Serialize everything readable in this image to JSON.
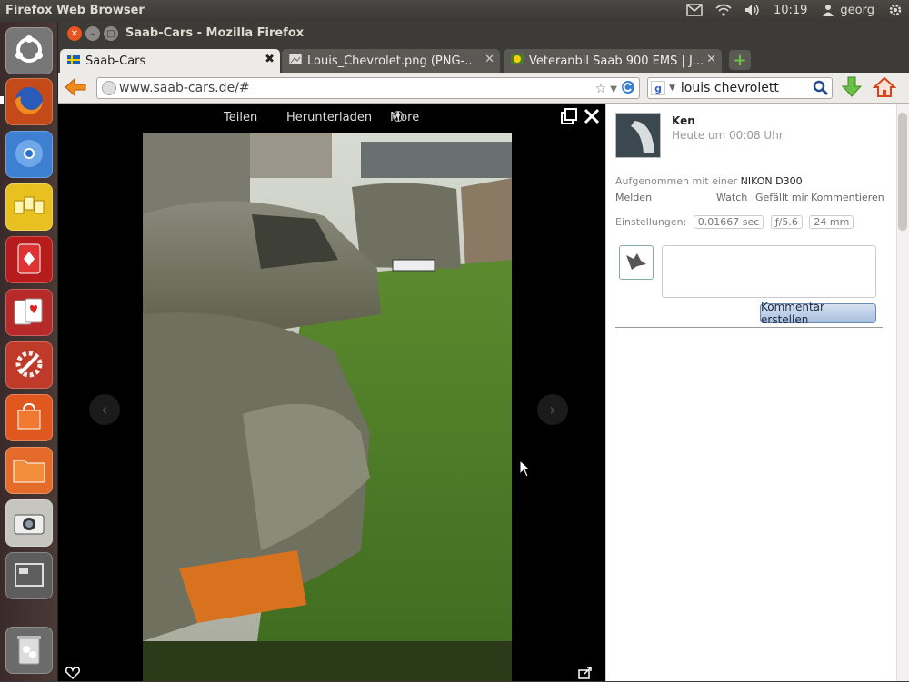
{
  "os": {
    "app_title": "Firefox Web Browser",
    "clock": "10:19",
    "user": "georg"
  },
  "window": {
    "title": "Saab-Cars - Mozilla Firefox"
  },
  "tabs": [
    {
      "label": "Saab-Cars"
    },
    {
      "label": "Louis_Chevrolet.png (PNG-..."
    },
    {
      "label": "Veteranbil Saab 900 EMS | J..."
    }
  ],
  "nav": {
    "url": "www.saab-cars.de/#",
    "search_engine": "g",
    "search_query": "louis chevrolett"
  },
  "viewer": {
    "menu_share": "Teilen",
    "menu_download": "Herunterladen",
    "menu_more": "More"
  },
  "sidebar": {
    "user_name": "Ken",
    "timestamp": "Heute um 00:08 Uhr",
    "camera_prefix": "Aufgenommen mit einer",
    "camera_model": "NIKON D300",
    "action_report": "Melden",
    "action_watch": "Watch",
    "action_like": "Gefällt mir",
    "action_comment": "Kommentieren",
    "settings_label": "Einstellungen:",
    "exposure": "0.01667 sec",
    "aperture": "ƒ/5.6",
    "focal": "24 mm",
    "submit_label": "Kommentar erstellen"
  },
  "colors": {
    "ubuntu_panel": "#3c3b37",
    "active_tab": "#ecebe8",
    "submit_button": "#b9cde4"
  }
}
